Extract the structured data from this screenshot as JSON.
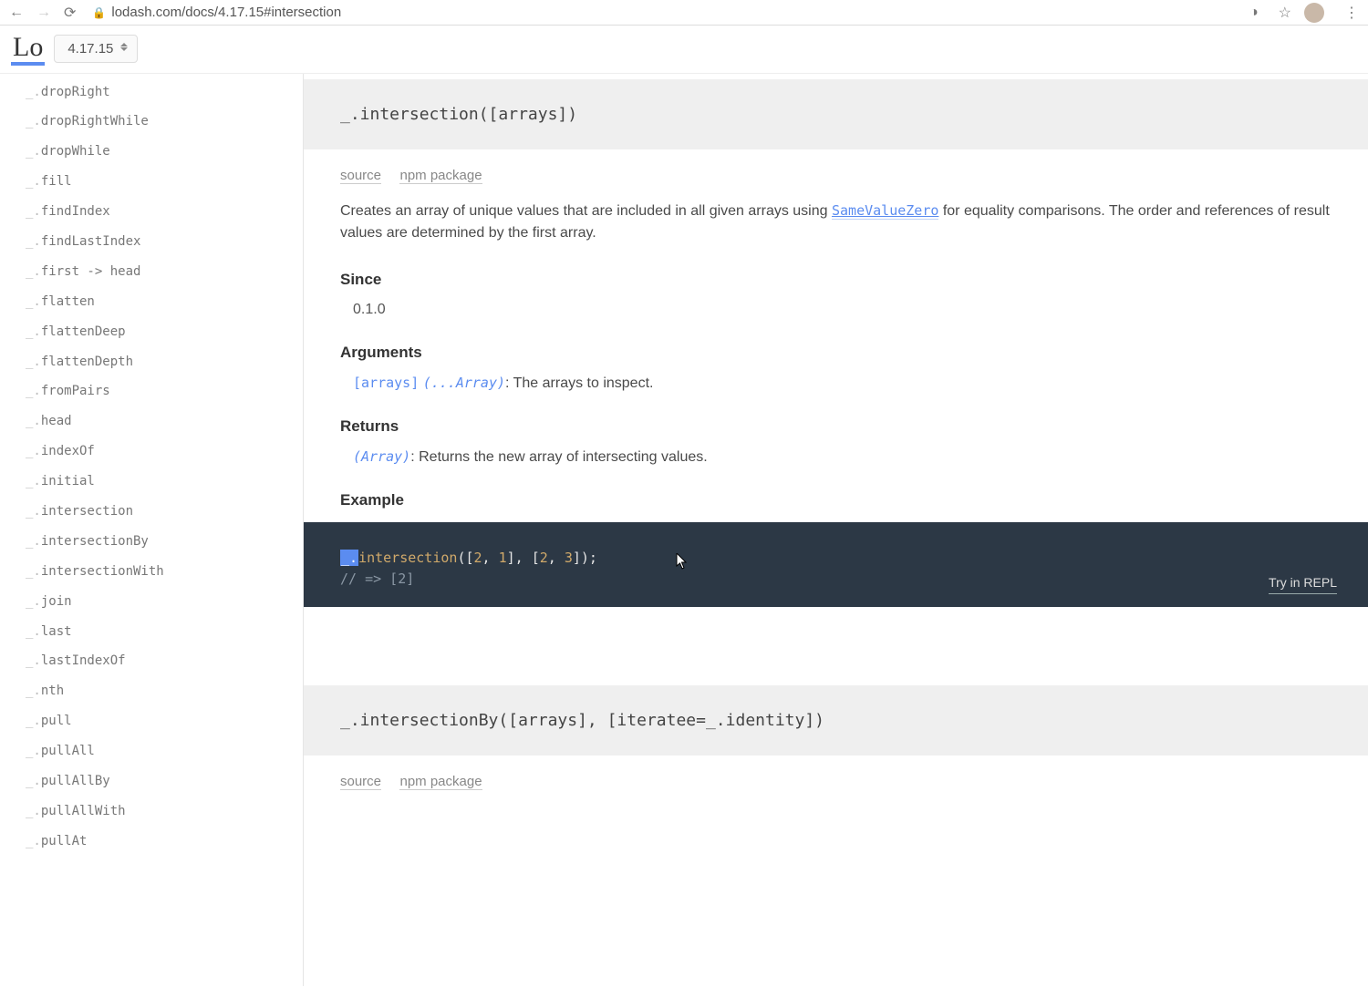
{
  "browser": {
    "url_text": "lodash.com/docs/4.17.15#intersection"
  },
  "header": {
    "logo": "Lo",
    "version": "4.17.15"
  },
  "sidebar": {
    "prefix": "_.",
    "items": [
      "dropRight",
      "dropRightWhile",
      "dropWhile",
      "fill",
      "findIndex",
      "findLastIndex",
      "first -> head",
      "flatten",
      "flattenDeep",
      "flattenDepth",
      "fromPairs",
      "head",
      "indexOf",
      "initial",
      "intersection",
      "intersectionBy",
      "intersectionWith",
      "join",
      "last",
      "lastIndexOf",
      "nth",
      "pull",
      "pullAll",
      "pullAllBy",
      "pullAllWith",
      "pullAt"
    ]
  },
  "main": {
    "signature": "_.intersection([arrays])",
    "links": {
      "source": "source",
      "npm": "npm package"
    },
    "description_pre": "Creates an array of unique values that are included in all given arrays using ",
    "description_link": "SameValueZero",
    "description_post": " for equality comparisons. The order and references of result values are determined by the first array.",
    "since_label": "Since",
    "since_value": "0.1.0",
    "arguments_label": "Arguments",
    "arg_name": "[arrays]",
    "arg_type": "(...Array)",
    "arg_desc": ": The arrays to inspect.",
    "returns_label": "Returns",
    "ret_type": "(Array)",
    "ret_desc": ": Returns the new array of intersecting values.",
    "example_label": "Example",
    "code": {
      "sel": "_.",
      "fn": "intersection",
      "rest1": "([",
      "n1": "2",
      "c1": ", ",
      "n2": "1",
      "c2": "], [",
      "n3": "2",
      "c3": ", ",
      "n4": "3",
      "c4": "]);",
      "comment": "// => [2]"
    },
    "repl": "Try in REPL"
  },
  "next": {
    "signature": "_.intersectionBy([arrays], [iteratee=_.identity])",
    "links": {
      "source": "source",
      "npm": "npm package"
    }
  }
}
